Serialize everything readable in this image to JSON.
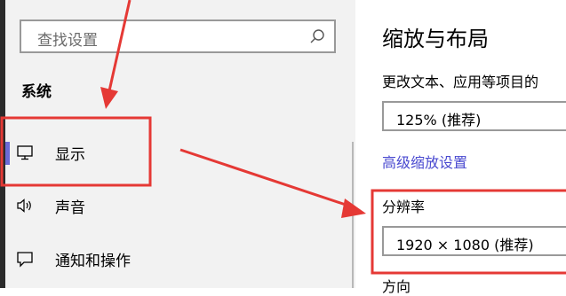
{
  "sidebar": {
    "search_placeholder": "查找设置",
    "heading": "系统",
    "items": [
      {
        "label": "显示",
        "icon": "monitor-icon",
        "active": true
      },
      {
        "label": "声音",
        "icon": "speaker-icon",
        "active": false
      },
      {
        "label": "通知和操作",
        "icon": "notification-icon",
        "active": false
      }
    ]
  },
  "main": {
    "title": "缩放与布局",
    "scale_description": "更改文本、应用等项目的",
    "scale_value": "125% (推荐)",
    "advanced_scaling_link": "高级缩放设置",
    "resolution_label": "分辨率",
    "resolution_value": "1920 × 1080 (推荐)",
    "orientation_label": "方向"
  },
  "colors": {
    "accent": "#6b69d6",
    "link": "#4a4ad0",
    "annotation_red": "#e53935",
    "sidebar_bg": "#f2f2f2"
  }
}
